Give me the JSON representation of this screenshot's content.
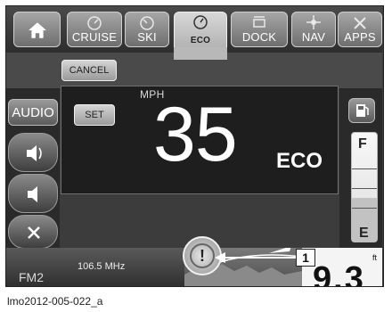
{
  "tabs": [
    {
      "label": ""
    },
    {
      "label": "CRUISE"
    },
    {
      "label": "SKI"
    },
    {
      "label": "ECO"
    },
    {
      "label": "DOCK"
    },
    {
      "label": "NAV"
    },
    {
      "label": "APPS"
    }
  ],
  "controls": {
    "cancel": "CANCEL",
    "set": "SET",
    "audio": "AUDIO"
  },
  "speed": {
    "unit": "MPH",
    "value": "35",
    "mode": "ECO"
  },
  "fuel": {
    "full": "F",
    "empty": "E",
    "level": 0.4
  },
  "radio": {
    "band": "FM2",
    "frequency": "106.5 MHz"
  },
  "depth": {
    "value": "9.3",
    "unit": "ft"
  },
  "callout": "1",
  "caption": "lmo2012-005-022_a",
  "icons": {
    "home": "home-icon",
    "cruise": "cruise-icon",
    "ski": "ski-icon",
    "eco": "eco-icon",
    "dock": "dock-icon",
    "nav": "nav-icon",
    "apps": "apps-icon",
    "volume_up": "volume-up-icon",
    "volume_down": "volume-down-icon",
    "mute": "mute-icon",
    "fuel": "fuel-pump-icon",
    "warning": "warning-icon"
  }
}
